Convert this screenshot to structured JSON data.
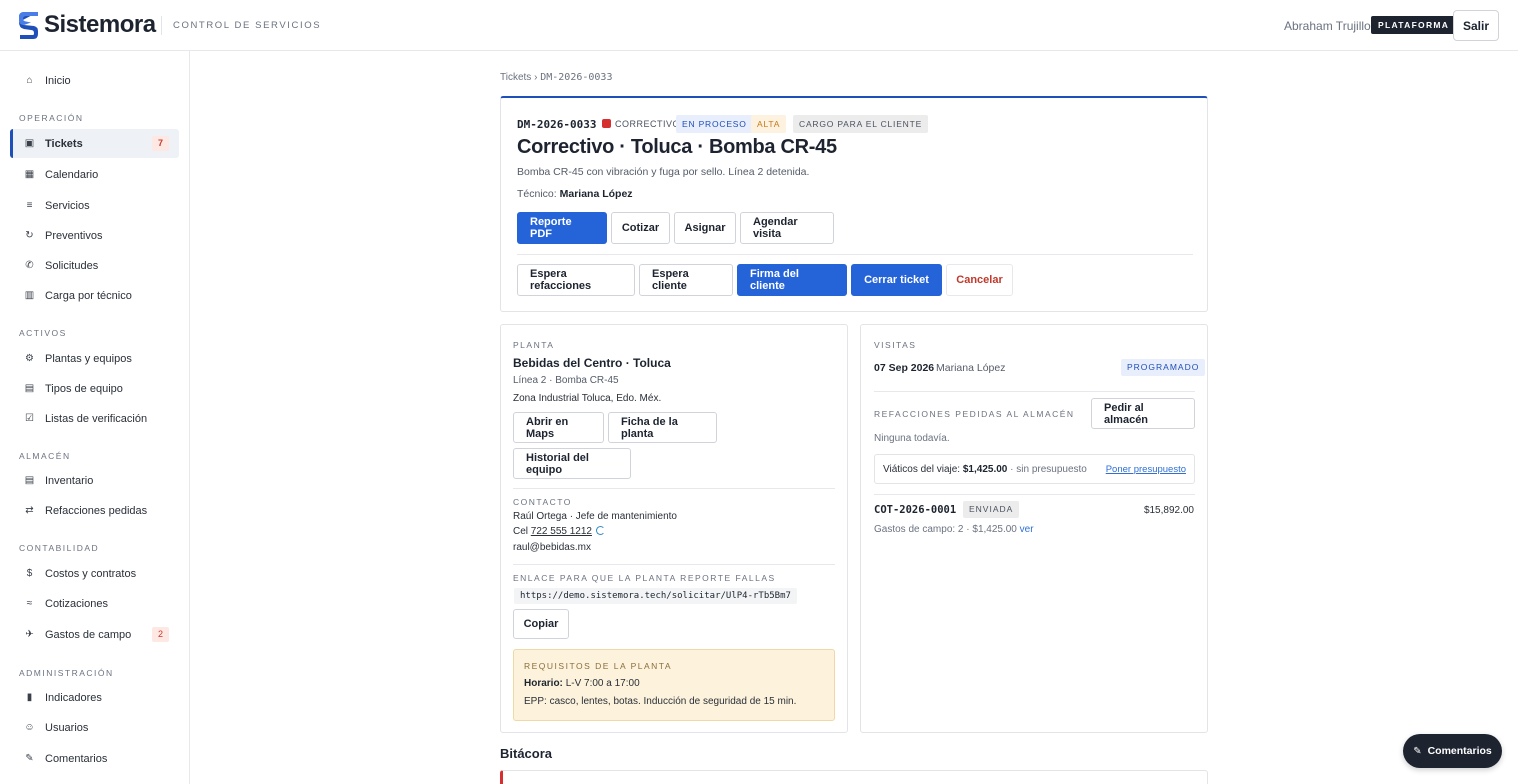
{
  "topbar": {
    "brand": "Sistemora",
    "subtitle": "CONTROL DE SERVICIOS",
    "user_name": "Abraham Trujillo",
    "badge": "PLATAFORMA",
    "exit_label": "Salir",
    "brand_color": "#1f4fb8"
  },
  "sidebar": {
    "home": "Inicio",
    "sections": {
      "operacion": "OPERACIÓN",
      "activos": "ACTIVOS",
      "almacen": "ALMACÉN",
      "contabilidad": "CONTABILIDAD",
      "administracion": "ADMINISTRACIÓN"
    },
    "items": {
      "tickets": "Tickets",
      "tickets_count": "7",
      "calendario": "Calendario",
      "servicios": "Servicios",
      "preventivos": "Preventivos",
      "solicitudes": "Solicitudes",
      "carga": "Carga por técnico",
      "plantas": "Plantas y equipos",
      "tipos": "Tipos de equipo",
      "listas": "Listas de verificación",
      "inventario": "Inventario",
      "refacciones": "Refacciones pedidas",
      "costos": "Costos y contratos",
      "cotizaciones": "Cotizaciones",
      "gastos": "Gastos de campo",
      "gastos_count": "2",
      "indicadores": "Indicadores",
      "usuarios": "Usuarios",
      "comentarios": "Comentarios"
    }
  },
  "breadcrumb": {
    "root": "Tickets",
    "sep": "›",
    "current": "DM-2026-0033"
  },
  "ticket": {
    "id": "DM-2026-0033",
    "type": "CORRECTIVO",
    "tags": {
      "status": "EN PROCESO",
      "priority": "ALTA",
      "billing": "CARGO PARA EL CLIENTE"
    },
    "title": "Correctivo · Toluca · Bomba CR-45",
    "description": "Bomba CR-45 con vibración y fuga por sello. Línea 2 detenida.",
    "tech_label": "Técnico:",
    "tech_name": "Mariana López",
    "actions": {
      "pdf": "Reporte PDF",
      "quote": "Cotizar",
      "assign": "Asignar",
      "schedule": "Agendar visita",
      "wait_parts": "Espera refacciones",
      "wait_client": "Espera cliente",
      "sign": "Firma del cliente",
      "close": "Cerrar ticket",
      "cancel": "Cancelar"
    }
  },
  "plant": {
    "label": "PLANTA",
    "name": "Bebidas del Centro · Toluca",
    "line": "Línea 2 · Bomba CR-45",
    "address": "Zona Industrial Toluca, Edo. Méx.",
    "buttons": {
      "maps": "Abrir en Maps",
      "sheet": "Ficha de la planta",
      "history": "Historial del equipo"
    },
    "contact_label": "CONTACTO",
    "contact_name": "Raúl Ortega · Jefe de mantenimiento",
    "phone_prefix": "Cel",
    "phone": "722 555 1212",
    "email": "raul@bebidas.mx",
    "link_label": "ENLACE PARA QUE LA PLANTA REPORTE FALLAS",
    "link_url": "https://demo.sistemora.tech/solicitar/UlP4-rTb5Bm7",
    "copy_label": "Copiar",
    "requirements": {
      "title": "REQUISITOS DE LA PLANTA",
      "hours_label": "Horario:",
      "hours": "L-V 7:00 a 17:00",
      "epp": "EPP: casco, lentes, botas. Inducción de seguridad de 15 min."
    }
  },
  "visits": {
    "label": "VISITAS",
    "date": "07 Sep 2026",
    "tech": "Mariana López",
    "status": "PROGRAMADO",
    "parts_label": "REFACCIONES PEDIDAS AL ALMACÉN",
    "parts_button": "Pedir al almacén",
    "none_yet": "Ninguna todavía.",
    "travel_label": "Viáticos del viaje:",
    "travel_amount": "$1,425.00",
    "travel_note": "· sin presupuesto",
    "travel_link": "Poner presupuesto",
    "quote_id": "COT-2026-0001",
    "quote_status": "ENVIADA",
    "quote_amount": "$15,892.00",
    "expenses_text": "Gastos de campo: 2 · $1,425.00",
    "expenses_link": "ver"
  },
  "log": {
    "title": "Bitácora"
  },
  "float": {
    "label": "Comentarios"
  }
}
